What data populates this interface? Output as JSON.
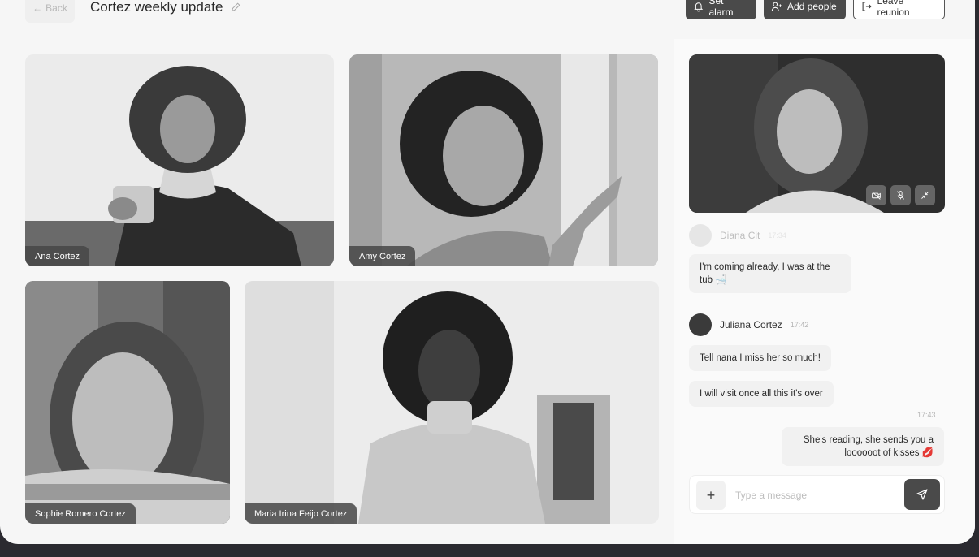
{
  "header": {
    "back_label": "Back",
    "meeting_title": "Cortez weekly update",
    "set_alarm_label": "Set alarm",
    "add_people_label": "Add people",
    "leave_label": "Leave reunion"
  },
  "participants": [
    {
      "name": "Ana Cortez"
    },
    {
      "name": "Amy Cortez"
    },
    {
      "name": "Sophie Romero Cortez"
    },
    {
      "name": "Maria Irina Feijo Cortez"
    }
  ],
  "chat": {
    "faded_sender": {
      "name": "Diana Cit",
      "time": "17:34"
    },
    "messages": [
      {
        "text": "I'm coming already, I was at the tub 🛁"
      },
      {
        "sender": "Juliana Cortez",
        "time": "17:42"
      },
      {
        "text": "Tell nana I miss her so much!"
      },
      {
        "text": "I will visit once all this it's over"
      },
      {
        "time": "17:43"
      },
      {
        "text": "She's reading, she sends you a loooooot of kisses 💋"
      }
    ],
    "composer_placeholder": "Type a message"
  },
  "colors": {
    "button_dark": "#4a4a4a",
    "background": "#f6f6f6",
    "frame": "#2b2a30"
  }
}
